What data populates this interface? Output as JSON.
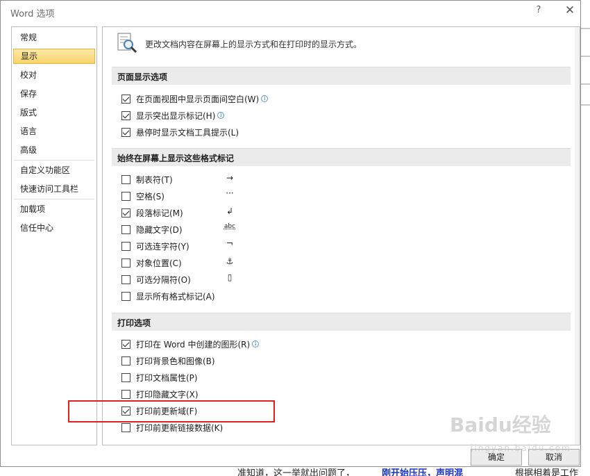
{
  "window": {
    "title": "Word 选项",
    "help": "?",
    "close": "✕"
  },
  "nav": {
    "items": [
      {
        "label": "常规"
      },
      {
        "label": "显示",
        "selected": true
      },
      {
        "label": "校对"
      },
      {
        "label": "保存"
      },
      {
        "label": "版式"
      },
      {
        "label": "语言"
      },
      {
        "label": "高级"
      },
      {
        "label": "自定义功能区"
      },
      {
        "label": "快速访问工具栏"
      },
      {
        "label": "加载项"
      },
      {
        "label": "信任中心"
      }
    ]
  },
  "panel": {
    "header": "更改文档内容在屏幕上的显示方式和在打印时的显示方式。",
    "sections": [
      {
        "title": "页面显示选项",
        "options": [
          {
            "label": "在页面视图中显示页面间空白(W)",
            "checked": true,
            "info": true
          },
          {
            "label": "显示突出显示标记(H)",
            "checked": true,
            "info": true
          },
          {
            "label": "悬停时显示文档工具提示(L)",
            "checked": true,
            "info": false
          }
        ]
      },
      {
        "title": "始终在屏幕上显示这些格式标记",
        "options": [
          {
            "label": "制表符(T)",
            "checked": false,
            "symbol": "→"
          },
          {
            "label": "空格(S)",
            "checked": false,
            "symbol": "···"
          },
          {
            "label": "段落标记(M)",
            "checked": true,
            "symbol": "↲"
          },
          {
            "label": "隐藏文字(D)",
            "checked": false,
            "symbol": "abc"
          },
          {
            "label": "可选连字符(Y)",
            "checked": false,
            "symbol": "¬"
          },
          {
            "label": "对象位置(C)",
            "checked": false,
            "symbol": "⚓"
          },
          {
            "label": "可选分隔符(O)",
            "checked": false,
            "symbol": "▯"
          },
          {
            "label": "显示所有格式标记(A)",
            "checked": false
          }
        ]
      },
      {
        "title": "打印选项",
        "options": [
          {
            "label": "打印在 Word 中创建的图形(R)",
            "checked": true,
            "info": true
          },
          {
            "label": "打印背景色和图像(B)",
            "checked": false
          },
          {
            "label": "打印文档属性(P)",
            "checked": false
          },
          {
            "label": "打印隐藏文字(X)",
            "checked": false
          },
          {
            "label": "打印前更新域(F)",
            "checked": true,
            "highlighted": true
          },
          {
            "label": "打印前更新链接数据(K)",
            "checked": false
          }
        ]
      }
    ]
  },
  "buttons": {
    "ok": "确定",
    "cancel": "取消"
  },
  "background": {
    "bottom_text_1": "准知道，这一举就出问题了，",
    "bottom_text_blue": "刚开始压压，声明混",
    "bottom_text_2": "根据相着是工作"
  },
  "watermark": {
    "logo": "Baidu经验",
    "sub": "jingyan.baidu.com"
  },
  "colors": {
    "selected_nav_bg": "#f7d36b",
    "section_bg": "#ebebeb",
    "highlight_box": "#e02020",
    "info_icon": "#3c7bc6"
  }
}
